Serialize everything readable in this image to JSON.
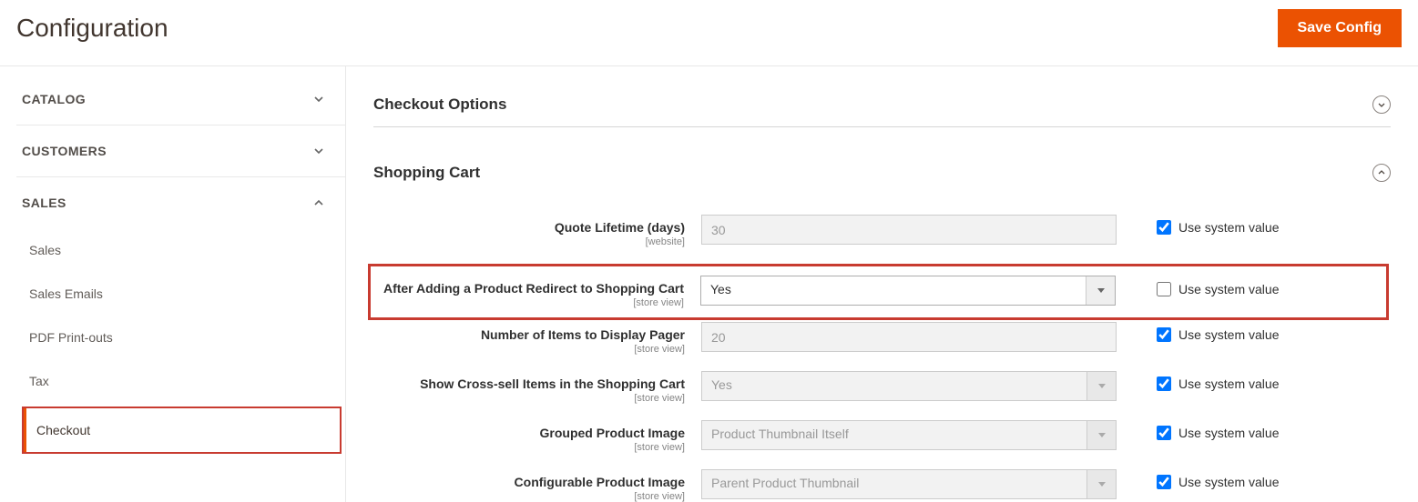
{
  "page_title": "Configuration",
  "save_button": "Save Config",
  "sidebar": {
    "sections": [
      {
        "label": "CATALOG",
        "expanded": false,
        "items": []
      },
      {
        "label": "CUSTOMERS",
        "expanded": false,
        "items": []
      },
      {
        "label": "SALES",
        "expanded": true,
        "items": [
          {
            "label": "Sales",
            "active": false
          },
          {
            "label": "Sales Emails",
            "active": false
          },
          {
            "label": "PDF Print-outs",
            "active": false
          },
          {
            "label": "Tax",
            "active": false
          },
          {
            "label": "Checkout",
            "active": true
          }
        ]
      }
    ]
  },
  "groups": {
    "checkout_options": {
      "title": "Checkout Options",
      "expanded": false
    },
    "shopping_cart": {
      "title": "Shopping Cart",
      "expanded": true
    }
  },
  "fields": {
    "quote_lifetime": {
      "label": "Quote Lifetime (days)",
      "scope": "[website]",
      "value": "30",
      "use_system": true,
      "use_system_label": "Use system value"
    },
    "redirect_cart": {
      "label": "After Adding a Product Redirect to Shopping Cart",
      "scope": "[store view]",
      "value": "Yes",
      "use_system": false,
      "use_system_label": "Use system value"
    },
    "items_pager": {
      "label": "Number of Items to Display Pager",
      "scope": "[store view]",
      "value": "20",
      "use_system": true,
      "use_system_label": "Use system value"
    },
    "cross_sell": {
      "label": "Show Cross-sell Items in the Shopping Cart",
      "scope": "[store view]",
      "value": "Yes",
      "use_system": true,
      "use_system_label": "Use system value"
    },
    "grouped_image": {
      "label": "Grouped Product Image",
      "scope": "[store view]",
      "value": "Product Thumbnail Itself",
      "use_system": true,
      "use_system_label": "Use system value"
    },
    "configurable_image": {
      "label": "Configurable Product Image",
      "scope": "[store view]",
      "value": "Parent Product Thumbnail",
      "use_system": true,
      "use_system_label": "Use system value"
    }
  }
}
